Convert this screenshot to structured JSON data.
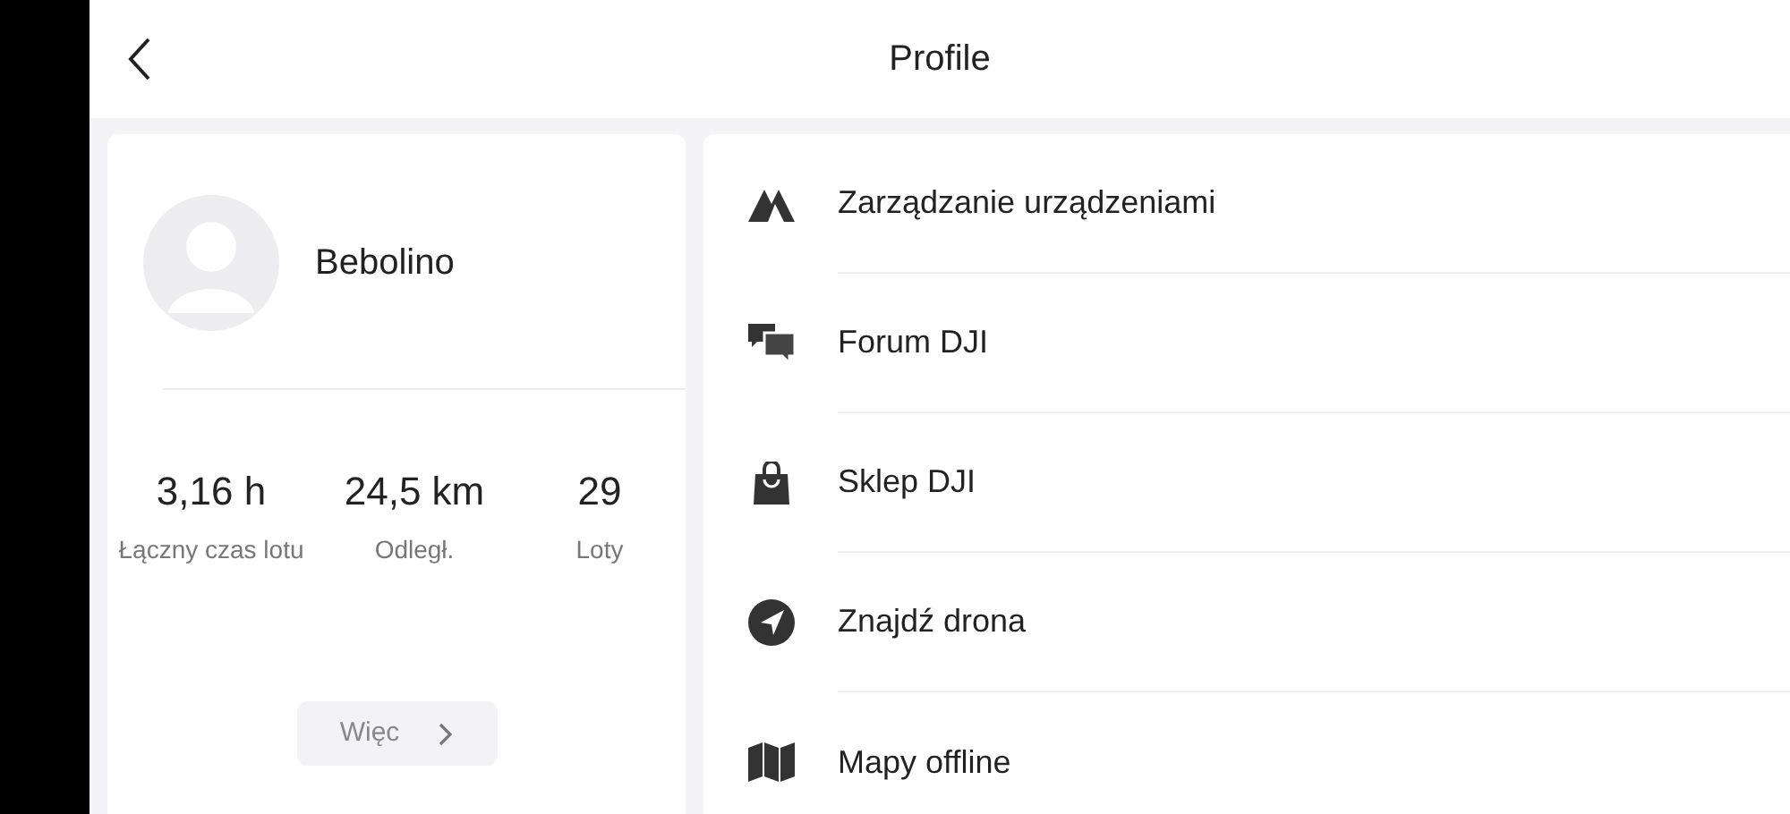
{
  "header": {
    "title": "Profile"
  },
  "profile": {
    "username": "Bebolino",
    "stats": [
      {
        "value": "3,16 h",
        "label": "Łączny czas lotu"
      },
      {
        "value": "24,5 km",
        "label": "Odległ."
      },
      {
        "value": "29",
        "label": "Loty"
      }
    ],
    "more_button": "Więc"
  },
  "menu": [
    {
      "label": "Zarządzanie urządzeniami"
    },
    {
      "label": "Forum DJI"
    },
    {
      "label": "Sklep DJI"
    },
    {
      "label": "Znajdź drona"
    },
    {
      "label": "Mapy offline"
    }
  ]
}
